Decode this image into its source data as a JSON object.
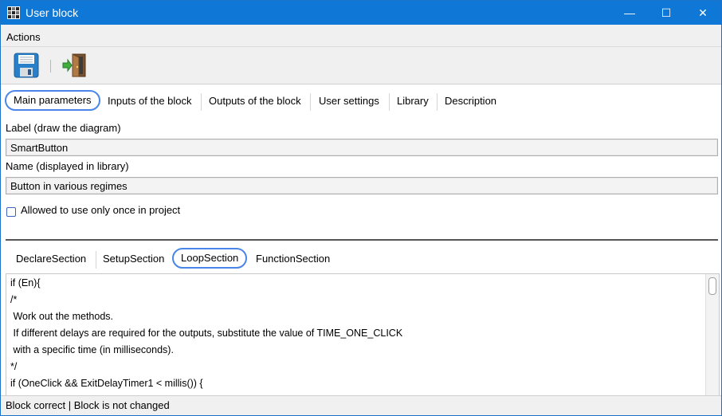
{
  "window": {
    "title": "User block",
    "controls": {
      "minimize": "—",
      "maximize": "☐",
      "close": "✕"
    }
  },
  "menubar": {
    "items": [
      "Actions"
    ]
  },
  "toolbar": {
    "buttons": [
      {
        "icon": "save-icon"
      },
      {
        "icon": "exit-door-icon"
      }
    ]
  },
  "tabs": [
    "Main parameters",
    "Inputs of the block",
    "Outputs of the block",
    "User settings",
    "Library",
    "Description"
  ],
  "active_tab": "Main parameters",
  "form": {
    "label_caption": "Label (draw the diagram)",
    "label_value": "SmartButton",
    "name_caption": "Name (displayed in library)",
    "name_value": "Button in various regimes",
    "once_checkbox_label": "Allowed to use only once in project",
    "once_checked": false
  },
  "code_tabs": [
    "DeclareSection",
    "SetupSection",
    "LoopSection",
    "FunctionSection"
  ],
  "active_code_tab": "LoopSection",
  "code_lines": [
    "if (En){",
    "/*",
    " Work out the methods.",
    " If different delays are required for the outputs, substitute the value of TIME_ONE_CLICK",
    " with a specific time (in milliseconds).",
    "*/",
    "if (OneClick && ExitDelayTimer1 < millis()) {"
  ],
  "status": "Block correct | Block is not changed",
  "colors": {
    "titlebar": "#0f78d7",
    "active_tab_border": "#4a86e8",
    "checkbox_border": "#3a63c4"
  }
}
